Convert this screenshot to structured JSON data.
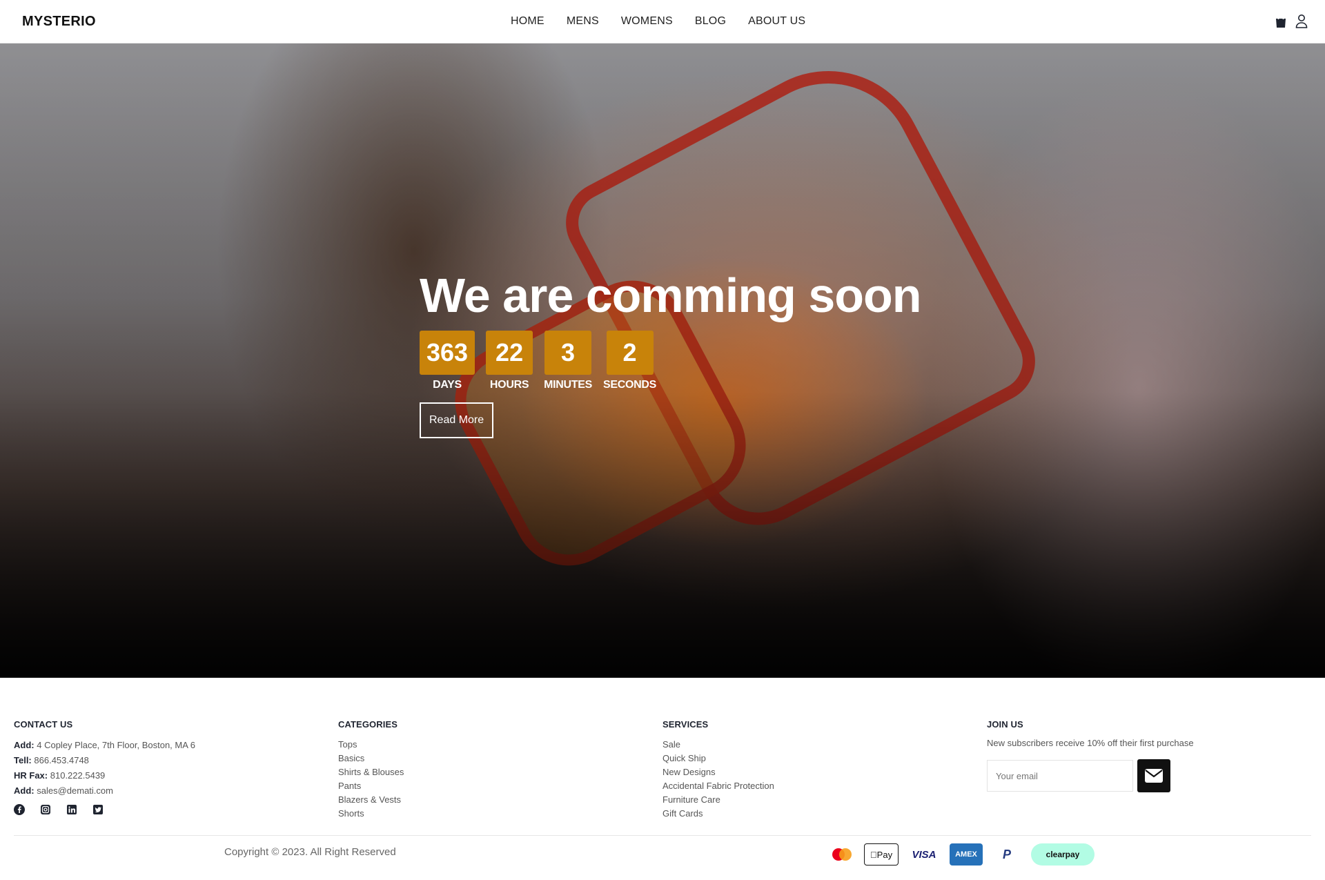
{
  "header": {
    "logo": "MYSTERIO",
    "nav": [
      "HOME",
      "MENS",
      "WOMENS",
      "BLOG",
      "ABOUT US"
    ],
    "icons": [
      "shopping-bag-icon",
      "user-icon"
    ]
  },
  "hero": {
    "title": "We are comming soon",
    "countdown": [
      {
        "value": "363",
        "label": "DAYS"
      },
      {
        "value": "22",
        "label": "HOURS"
      },
      {
        "value": "3",
        "label": "MINUTES"
      },
      {
        "value": "2",
        "label": "SECONDS"
      }
    ],
    "cta": "Read More",
    "accent_color": "#c8830a"
  },
  "footer": {
    "contact": {
      "heading": "CONTACT US",
      "address_label": "Add:",
      "address": "4 Copley Place, 7th Floor, Boston, MA 6",
      "tel_label": "Tell:",
      "tel": "866.453.4748",
      "fax_label": "HR Fax:",
      "fax": "810.222.5439",
      "email_label": "Add:",
      "email": "sales@demati.com",
      "social": [
        "facebook-icon",
        "instagram-icon",
        "linkedin-icon",
        "twitter-icon"
      ]
    },
    "categories": {
      "heading": "CATEGORIES",
      "items": [
        "Tops",
        "Basics",
        "Shirts & Blouses",
        "Pants",
        "Blazers & Vests",
        "Shorts"
      ]
    },
    "services": {
      "heading": "SERVICES",
      "items": [
        "Sale",
        "Quick Ship",
        "New Designs",
        "Accidental Fabric Protection",
        "Furniture Care",
        "Gift Cards"
      ]
    },
    "join": {
      "heading": "JOIN US",
      "text": "New subscribers receive 10% off their first purchase",
      "placeholder": "Your email"
    },
    "copyright": "Copyright © 2023. All Right Reserved",
    "payments": [
      "Mastercard",
      "Pay",
      "VISA",
      "AMEX",
      "PayPal",
      "clearpay"
    ]
  }
}
